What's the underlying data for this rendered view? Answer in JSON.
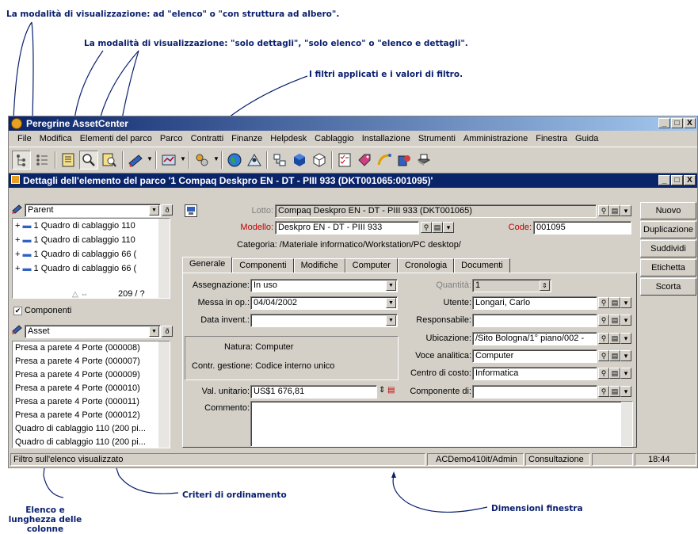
{
  "annotations": {
    "tree_or_list": "La modalità di visualizzazione: ad \"elenco\" o \"con struttura ad albero\".",
    "detail_modes": "La modalità di visualizzazione: \"solo dettagli\", \"solo elenco\" o \"elenco e dettagli\".",
    "filters": "I filtri applicati e i valori di filtro.",
    "sort": "Criteri di ordinamento",
    "columns": "Elenco e lunghezza delle colonne",
    "window_size": "Dimensioni finestra"
  },
  "app": {
    "title": "Peregrine AssetCenter",
    "window_buttons": [
      "_",
      "□",
      "X"
    ]
  },
  "menu": [
    "File",
    "Modifica",
    "Elementi del parco",
    "Parco",
    "Contratti",
    "Finanze",
    "Helpdesk",
    "Cablaggio",
    "Installazione",
    "Strumenti",
    "Amministrazione",
    "Finestra",
    "Guida"
  ],
  "toolbar_icons": [
    "tree-view-icon",
    "list-view-icon",
    "details-only-icon",
    "list-only-icon",
    "list-and-details-icon",
    "filter-icon",
    "report-icon",
    "wizard-icon",
    "globe-icon",
    "people-icon",
    "organization-icon",
    "cube-icon",
    "box-icon",
    "checklist-icon",
    "tag-icon",
    "cable-icon",
    "software-icon",
    "printer-icon"
  ],
  "doc": {
    "title": "Dettagli dell'elemento del parco '1 Compaq Deskpro EN - DT - PIII 933 (DKT001065:001095)'"
  },
  "left": {
    "filter_top": "Parent",
    "tree_items": [
      "1  Quadro di cablaggio 110",
      "1  Quadro di cablaggio 110",
      "1  Quadro di cablaggio 66 (",
      "1  Quadro di cablaggio 66 ("
    ],
    "count": "209 / ?",
    "checkbox_label": "Componenti",
    "filter_bottom": "Asset",
    "list_items": [
      "Presa a parete 4 Porte (000008)",
      "Presa a parete 4 Porte (000007)",
      "Presa a parete 4 Porte (000009)",
      "Presa a parete 4 Porte (000010)",
      "Presa a parete 4 Porte (000011)",
      "Presa a parete 4 Porte (000012)",
      "Quadro di cablaggio 110 (200 pi...",
      "Quadro di cablaggio 110 (200 pi..."
    ]
  },
  "header": {
    "lotto_label": "Lotto:",
    "lotto_value": "Compaq Deskpro EN - DT - PIII 933 (DKT001065)",
    "modello_label": "Modello:",
    "modello_value": "Deskpro EN - DT - PIII 933",
    "code_label": "Code:",
    "code_value": "001095",
    "categoria": "Categoria: /Materiale informatico/Workstation/PC desktop/"
  },
  "tabs": [
    "Generale",
    "Componenti",
    "Modifiche",
    "Computer",
    "Cronologia",
    "Documenti"
  ],
  "form": {
    "assegnazione_label": "Assegnazione:",
    "assegnazione_value": "In uso",
    "messa_label": "Messa in op.:",
    "messa_value": "04/04/2002",
    "data_label": "Data invent.:",
    "data_value": "",
    "natura": "Natura: Computer",
    "contr": "Contr. gestione: Codice interno unico",
    "val_label": "Val. unitario:",
    "val_value": "US$1 676,81",
    "commento_label": "Commento:",
    "quantita_label": "Quantità:",
    "quantita_value": "1",
    "utente_label": "Utente:",
    "utente_value": "Longari, Carlo",
    "responsabile_label": "Responsabile:",
    "responsabile_value": "",
    "ubicazione_label": "Ubicazione:",
    "ubicazione_value": "/Sito Bologna/1° piano/002 -",
    "voce_label": "Voce analitica:",
    "voce_value": "Computer",
    "centro_label": "Centro di costo:",
    "centro_value": "Informatica",
    "componente_label": "Componente di:",
    "componente_value": ""
  },
  "buttons": [
    "Nuovo",
    "Duplicazione",
    "Suddividi",
    "Etichetta",
    "Scorta"
  ],
  "status": {
    "left": "Filtro sull'elenco visualizzato",
    "user": "ACDemo410it/Admin",
    "mode": "Consultazione",
    "time": "18:44"
  }
}
